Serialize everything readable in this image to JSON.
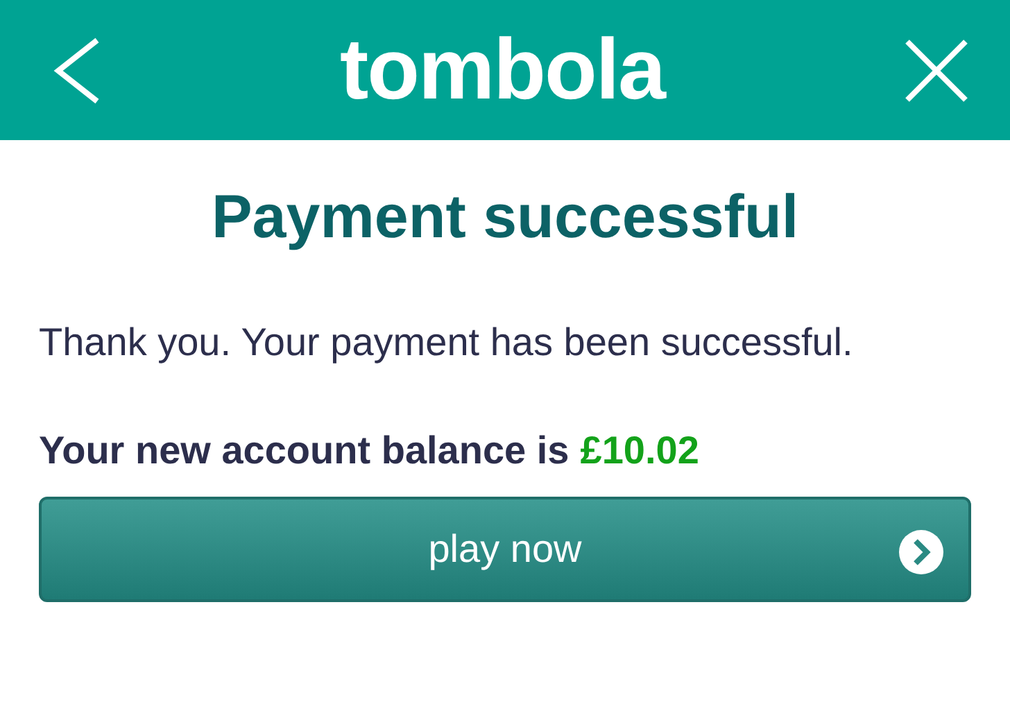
{
  "header": {
    "logo": "tombola"
  },
  "title": "Payment successful",
  "message": "Thank you. Your payment has been successful.",
  "balance": {
    "label": "Your new account balance is",
    "amount": "£10.02"
  },
  "button": {
    "label": "play now"
  }
}
